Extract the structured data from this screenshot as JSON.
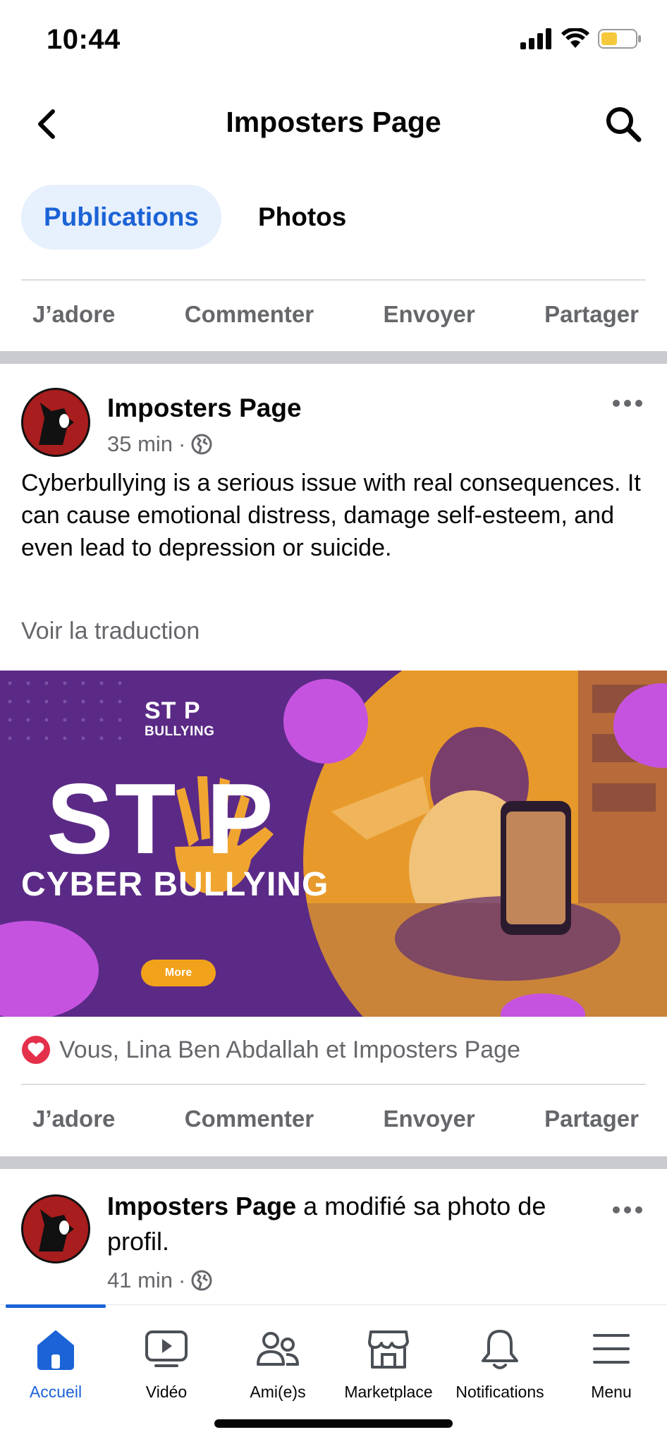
{
  "status_bar": {
    "time": "10:44"
  },
  "header": {
    "title": "Imposters Page"
  },
  "tabs": [
    {
      "label": "Publications",
      "active": true
    },
    {
      "label": "Photos",
      "active": false
    }
  ],
  "actions": {
    "like": "J’adore",
    "comment": "Commenter",
    "send": "Envoyer",
    "share": "Partager"
  },
  "post1": {
    "author": "Imposters Page",
    "time": "35 min",
    "dot": "·",
    "text": "Cyberbullying is a serious issue with real consequences. It can cause emotional distress, damage self-esteem, and even lead to depression or suicide.",
    "see_translation": "Voir la traduction",
    "image": {
      "stop_small": "ST P",
      "bullying_small": "BULLYING",
      "stop_big": "ST  P",
      "cyber_bullying": "CYBER BULLYING",
      "more": "More"
    },
    "reactions": "Vous, Lina Ben Abdallah et Imposters Page"
  },
  "post2": {
    "author": "Imposters Page",
    "action": " a modifié sa photo de profil.",
    "time": "41 min",
    "dot": "·"
  },
  "bottom_nav": [
    {
      "label": "Accueil",
      "icon": "home-icon",
      "active": true
    },
    {
      "label": "Vidéo",
      "icon": "video-icon",
      "active": false
    },
    {
      "label": "Ami(e)s",
      "icon": "friends-icon",
      "active": false
    },
    {
      "label": "Marketplace",
      "icon": "marketplace-icon",
      "active": false
    },
    {
      "label": "Notifications",
      "icon": "bell-icon",
      "active": false
    },
    {
      "label": "Menu",
      "icon": "menu-icon",
      "active": false
    }
  ],
  "colors": {
    "accent": "#1b63d6",
    "tab_active_bg": "#e7f0fd",
    "muted": "#65676b",
    "separator": "#cacbd0",
    "heart": "#e4304b"
  }
}
